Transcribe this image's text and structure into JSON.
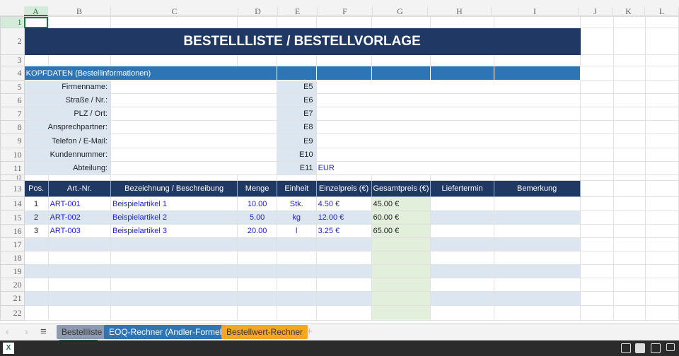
{
  "columns": [
    "A",
    "B",
    "C",
    "D",
    "E",
    "F",
    "G",
    "H",
    "I",
    "J",
    "K",
    "L"
  ],
  "title": "BESTELLLISTE / BESTELLVORLAGE",
  "section_header": "KOPFDATEN (Bestellinformationen)",
  "header_fields": [
    {
      "row": 5,
      "label": "Firmenname:",
      "ref": "E5",
      "value": ""
    },
    {
      "row": 6,
      "label": "Straße / Nr.:",
      "ref": "E6",
      "value": ""
    },
    {
      "row": 7,
      "label": "PLZ / Ort:",
      "ref": "E7",
      "value": ""
    },
    {
      "row": 8,
      "label": "Ansprechpartner:",
      "ref": "E8",
      "value": ""
    },
    {
      "row": 9,
      "label": "Telefon / E-Mail:",
      "ref": "E9",
      "value": ""
    },
    {
      "row": 10,
      "label": "Kundennummer:",
      "ref": "E10",
      "value": ""
    },
    {
      "row": 11,
      "label": "Abteilung:",
      "ref": "E11",
      "value": "EUR"
    }
  ],
  "table_headers": [
    "Pos.",
    "Art.-Nr.",
    "Bezeichnung / Beschreibung",
    "Menge",
    "Einheit",
    "Einzelpreis (€)",
    "Gesamtpreis (€)",
    "Liefertermin",
    "Bemerkung"
  ],
  "items": [
    [
      "1",
      "ART-001",
      "Beispielartikel 1",
      "10.00",
      "Stk.",
      "4.50 €",
      "45.00 €",
      "",
      ""
    ],
    [
      "2",
      "ART-002",
      "Beispielartikel 2",
      "5.00",
      "kg",
      "12.00 €",
      "60.00 €",
      "",
      ""
    ],
    [
      "3",
      "ART-003",
      "Beispielartikel 3",
      "20.00",
      "l",
      "3.25 €",
      "65.00 €",
      "",
      ""
    ]
  ],
  "selected_cell": "A1",
  "sheet_tabs": [
    {
      "label": "Bestellliste",
      "color": "#8e9aaf",
      "active": true
    },
    {
      "label": "EOQ-Rechner (Andler-Formel)",
      "color": "#2e75b6",
      "active": false
    },
    {
      "label": "Bestellwert-Rechner",
      "color": "#f5a623",
      "active": false
    }
  ],
  "colors": {
    "title_bg": "#1f3864",
    "section_bg": "#2e75b6",
    "label_bg": "#dce6f1",
    "total_bg": "#e2efda",
    "input_text": "#2121d6"
  }
}
